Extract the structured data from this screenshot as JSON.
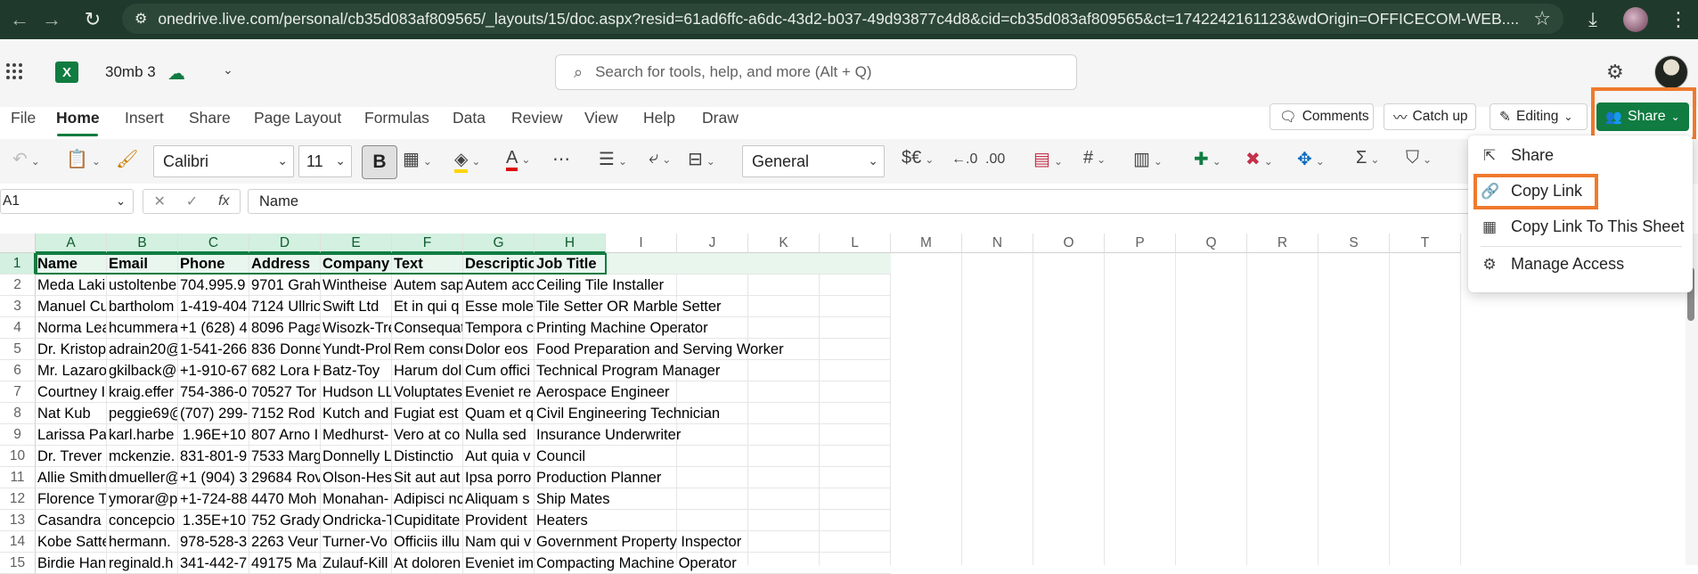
{
  "browser": {
    "url": "onedrive.live.com/personal/cb35d083af809565/_layouts/15/doc.aspx?resid=61ad6ffc-a6dc-43d2-b037-49d93877c4d8&cid=cb35d083af809565&ct=1742242161123&wdOrigin=OFFICECOM-WEB...."
  },
  "app": {
    "doc_title": "30mb 3",
    "search_placeholder": "Search for tools, help, and more (Alt + Q)"
  },
  "menu": {
    "tabs": [
      "File",
      "Home",
      "Insert",
      "Share",
      "Page Layout",
      "Formulas",
      "Data",
      "Review",
      "View",
      "Help",
      "Draw"
    ],
    "active_tab": "Home"
  },
  "header_buttons": {
    "comments": "Comments",
    "catch_up": "Catch up",
    "editing": "Editing",
    "share": "Share"
  },
  "ribbon": {
    "font": "Calibri",
    "font_size": "11",
    "bold": "B",
    "number_format": "General",
    "currency": "$€",
    "sum": "Σ"
  },
  "formula_bar": {
    "name_box": "A1",
    "fx": "fx",
    "content": "Name"
  },
  "grid": {
    "columns": [
      "A",
      "B",
      "C",
      "D",
      "E",
      "F",
      "G",
      "H",
      "I",
      "J",
      "K",
      "L",
      "M",
      "N",
      "O",
      "P",
      "Q",
      "R",
      "S",
      "T"
    ],
    "selected_columns": [
      "A",
      "B",
      "C",
      "D",
      "E",
      "F",
      "G",
      "H"
    ],
    "rows": [
      {
        "n": "1",
        "cells": [
          "Name",
          "Email",
          "Phone",
          "Address",
          "Company",
          "Text",
          "Descriptio",
          "Job Title"
        ]
      },
      {
        "n": "2",
        "cells": [
          "Meda Laki",
          "ustoltenbe",
          "704.995.9",
          "9701 Grah",
          "Wintheise",
          "Autem sap",
          "Autem acc",
          "Ceiling Tile Installer"
        ]
      },
      {
        "n": "3",
        "cells": [
          "Manuel Cu",
          "bartholom",
          "1-419-404",
          "7124 Ullric",
          "Swift Ltd",
          "Et in qui q",
          "Esse mole",
          "Tile Setter OR Marble Setter"
        ]
      },
      {
        "n": "4",
        "cells": [
          "Norma Lea",
          "hcummera",
          "+1 (628) 4",
          "8096 Paga",
          "Wisozk-Tre",
          "Consequat",
          "Tempora c",
          "Printing Machine Operator"
        ]
      },
      {
        "n": "5",
        "cells": [
          "Dr. Kristop",
          "adrain20@",
          "1-541-266",
          "836 Donne",
          "Yundt-Prol",
          "Rem conse",
          "Dolor eos",
          "Food Preparation and Serving Worker"
        ]
      },
      {
        "n": "6",
        "cells": [
          "Mr. Lazaro",
          "gkilback@",
          "+1-910-67",
          "682 Lora H",
          "Batz-Toy",
          "Harum dol",
          "Cum offici",
          "Technical Program Manager"
        ]
      },
      {
        "n": "7",
        "cells": [
          "Courtney I",
          "kraig.effer",
          "754-386-0",
          "70527 Tor",
          "Hudson LL",
          "Voluptates",
          "Eveniet re",
          "Aerospace Engineer"
        ]
      },
      {
        "n": "8",
        "cells": [
          "Nat Kub",
          "peggie69@",
          "(707) 299-",
          "7152 Rod",
          "Kutch and",
          "Fugiat est",
          "Quam et q",
          "Civil Engineering Technician"
        ]
      },
      {
        "n": "9",
        "cells": [
          "Larissa Pa",
          "karl.harbe",
          "1.96E+10",
          "807 Arno I",
          "Medhurst-",
          "Vero at co",
          "Nulla sed",
          "Insurance Underwriter"
        ]
      },
      {
        "n": "10",
        "cells": [
          "Dr. Trever",
          "mckenzie.",
          "831-801-9",
          "7533 Marg",
          "Donnelly L",
          "Distinctio",
          "Aut quia v",
          "Council"
        ]
      },
      {
        "n": "11",
        "cells": [
          "Allie Smith",
          "dmueller@",
          "+1 (904) 3",
          "29684 Rov",
          "Olson-Hes",
          "Sit aut aut",
          "Ipsa porro",
          "Production Planner"
        ]
      },
      {
        "n": "12",
        "cells": [
          "Florence T",
          "ymorar@p",
          "+1-724-88",
          "4470 Moh",
          "Monahan-",
          "Adipisci nc",
          "Aliquam s",
          "Ship Mates"
        ]
      },
      {
        "n": "13",
        "cells": [
          "Casandra I",
          "concepcio",
          "1.35E+10",
          "752 Grady",
          "Ondricka-T",
          "Cupiditate",
          "Provident",
          "Heaters"
        ]
      },
      {
        "n": "14",
        "cells": [
          "Kobe Satte",
          "hermann.",
          "978-528-3",
          "2263 Veur",
          "Turner-Vo",
          "Officiis illu",
          "Nam qui v",
          "Government Property Inspector"
        ]
      },
      {
        "n": "15",
        "cells": [
          "Birdie Han",
          "reginald.h",
          "341-442-7",
          "49175 Ma",
          "Zulauf-Kill",
          "At doloren",
          "Eveniet im",
          "Compacting Machine Operator"
        ]
      }
    ]
  },
  "share_menu": {
    "items": [
      "Share",
      "Copy Link",
      "Copy Link To This Sheet",
      "Manage Access"
    ]
  },
  "colors": {
    "accent": "#107c41",
    "highlight": "#ef7a2d",
    "browser_bg": "#1f3a2c"
  }
}
